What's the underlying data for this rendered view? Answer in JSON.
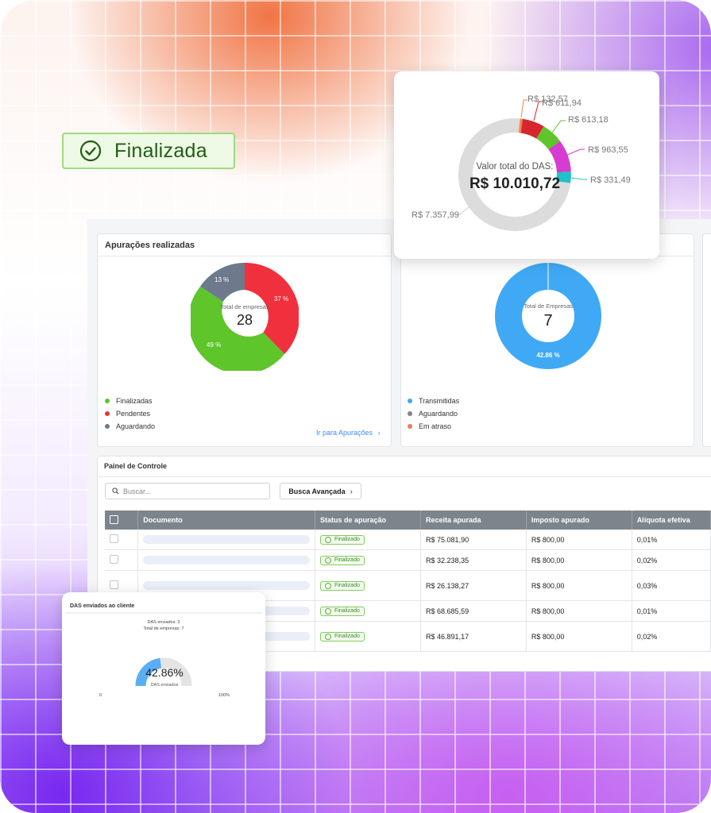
{
  "badge": {
    "label": "Finalizada"
  },
  "apuracoes": {
    "title": "Apurações realizadas",
    "center_label": "Total de empresas",
    "center_value": "28",
    "labels": {
      "finalizadas": "49 %",
      "pendentes": "37 %",
      "aguardando": "13 %"
    },
    "legend": [
      "Finalizadas",
      "Pendentes",
      "Aguardando"
    ],
    "link": "Ir para Apurações",
    "colors": {
      "finalizadas": "#5ec52b",
      "pendentes": "#f0303c",
      "aguardando": "#6c7a8c"
    }
  },
  "envios": {
    "center_label": "Total de Empresas",
    "center_value": "7",
    "slice_label": "42.86 %",
    "legend": [
      "Transmitidas",
      "Aguardando",
      "Em atraso"
    ],
    "colors": {
      "transmitidas": "#3fa9f5",
      "aguardando": "#7d858c",
      "atraso": "#f07a5a"
    }
  },
  "painel": {
    "title": "Painel de Controle",
    "search_placeholder": "Buscar...",
    "advanced_label": "Busca Avançada",
    "columns": [
      "Documento",
      "Status de apuração",
      "Receita apurada",
      "Imposto apurado",
      "Alíquota efetiva"
    ],
    "rows": [
      {
        "status": "Finalizado",
        "receita": "R$ 75.081,90",
        "imposto": "R$ 800,00",
        "aliquota": "0,01%"
      },
      {
        "status": "Finalizado",
        "receita": "R$ 32.238,35",
        "imposto": "R$ 800,00",
        "aliquota": "0,02%"
      },
      {
        "status": "Finalizado",
        "receita": "R$ 26.138,27",
        "imposto": "R$ 800,00",
        "aliquota": "0,03%"
      },
      {
        "status": "Finalizado",
        "receita": "R$ 68.685,59",
        "imposto": "R$ 800,00",
        "aliquota": "0,01%"
      },
      {
        "status": "Finalizado",
        "receita": "R$ 46.891,17",
        "imposto": "R$ 800,00",
        "aliquota": "0,02%"
      }
    ]
  },
  "das_chart": {
    "center_title": "Valor total do DAS:",
    "center_value": "R$ 10.010,72",
    "labels": [
      "R$ 132,57",
      "R$ 611,94",
      "R$ 613,18",
      "R$ 963,55",
      "R$ 331,49",
      "R$ 7.357,99"
    ]
  },
  "gauge": {
    "title": "DAS enviados ao cliente",
    "line1": "DAS enviados: 3",
    "line2": "Total de empresas: 7",
    "value": "42.86%",
    "sub": "DAS enviados",
    "min": "0",
    "max": "100%"
  },
  "chart_data": [
    {
      "type": "pie",
      "labels": [
        "Finalizadas",
        "Pendentes",
        "Aguardando"
      ],
      "values": [
        49,
        37,
        13
      ]
    },
    {
      "type": "pie",
      "labels": [
        "Transmitidas"
      ],
      "values": [
        42.86
      ]
    },
    {
      "type": "pie",
      "labels": [
        "R$ 132,57",
        "R$ 611,94",
        "R$ 613,18",
        "R$ 963,55",
        "R$ 331,49",
        "R$ 7.357,99"
      ],
      "values": [
        132.57,
        611.94,
        613.18,
        963.55,
        331.49,
        7357.99
      ]
    }
  ]
}
